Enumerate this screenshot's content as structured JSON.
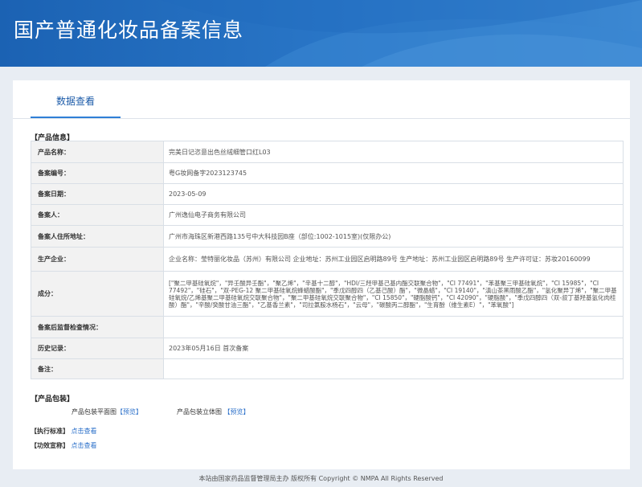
{
  "header": {
    "title": "国产普通化妆品备案信息"
  },
  "tabs": [
    {
      "label": "数据查看"
    }
  ],
  "product_info": {
    "section_title": "【产品信息】",
    "rows": [
      {
        "label": "产品名称：",
        "value": "完美日记恣意出色丝绒细管口红L03"
      },
      {
        "label": "备案编号：",
        "value": "粤G妆网备字2023123745"
      },
      {
        "label": "备案日期：",
        "value": "2023-05-09"
      },
      {
        "label": "备案人：",
        "value": "广州逸仙电子商务有限公司"
      },
      {
        "label": "备案人住所地址：",
        "value": "广州市海珠区新港西路135号中大科技园B座（部位:1002-1015室)(仅限办公)"
      },
      {
        "label": "生产企业：",
        "value": "企业名称：莹特丽化妆品（苏州）有限公司 企业地址：苏州工业园区启明路89号 生产地址：苏州工业园区启明路89号 生产许可证：苏妆20160099"
      },
      {
        "label": "成分：",
        "value": "[\"聚二甲基硅氧烷\"，\"异壬酸异壬酯\"，\"聚乙烯\"，\"辛基十二醇\"，\"HDI/三羟甲基己基内酯交联聚合物\"，\"CI 77491\"，\"苯基聚三甲基硅氧烷\"，\"CI 15985\"，\"CI 77492\"，\"硅石\"，\"双-PEG-12 聚二甲基硅氧烷蜂蜡酸酯\"，\"季戊四醇四（乙基己酸）酯\"，\"微晶蜡\"，\"CI 19140\"，\"滇山茶黑雨酸乙酯\"，\"氢化聚异丁烯\"，\"聚二甲基硅氧烷/乙烯基聚二甲基硅氧烷交联聚合物\"，\"聚二甲基硅氧烷交联聚合物\"，\"CI 15850\"，\"硬脂酸钙\"，\"CI 42090\"，\"硬脂酸\"，\"季戊四醇四（双-叔丁基羟基氢化肉桂酸）酯\"，\"辛酸/癸酸甘油三酯\"，\"乙基香兰素\"，\"司拉氯胺水杨石\"，\"云母\"，\"碳酸丙二醇酯\"，\"生育酚（维生素E）\"，\"苯氧酸\"]"
      },
      {
        "label": "备案后监督检查情况：",
        "value": ""
      },
      {
        "label": "历史记录：",
        "value": "2023年05月16日 首次备案"
      },
      {
        "label": "备注：",
        "value": ""
      }
    ]
  },
  "packaging": {
    "section_title": "【产品包装】",
    "flat_label": "产品包装平面图",
    "flat_link": "【预览】",
    "solid_label": "产品包装立体图",
    "solid_link": "【预览】"
  },
  "standard": {
    "label": "【执行标准】",
    "link": "点击查看"
  },
  "efficacy": {
    "label": "【功效宣称】",
    "link": "点击查看"
  },
  "footer": {
    "text": "本站由国家药品监督管理局主办 版权所有 Copyright © NMPA All Rights Reserved"
  },
  "colors": {
    "banner": "#2a77c8",
    "accent": "#2f7fd6",
    "link": "#2a6fc9"
  }
}
